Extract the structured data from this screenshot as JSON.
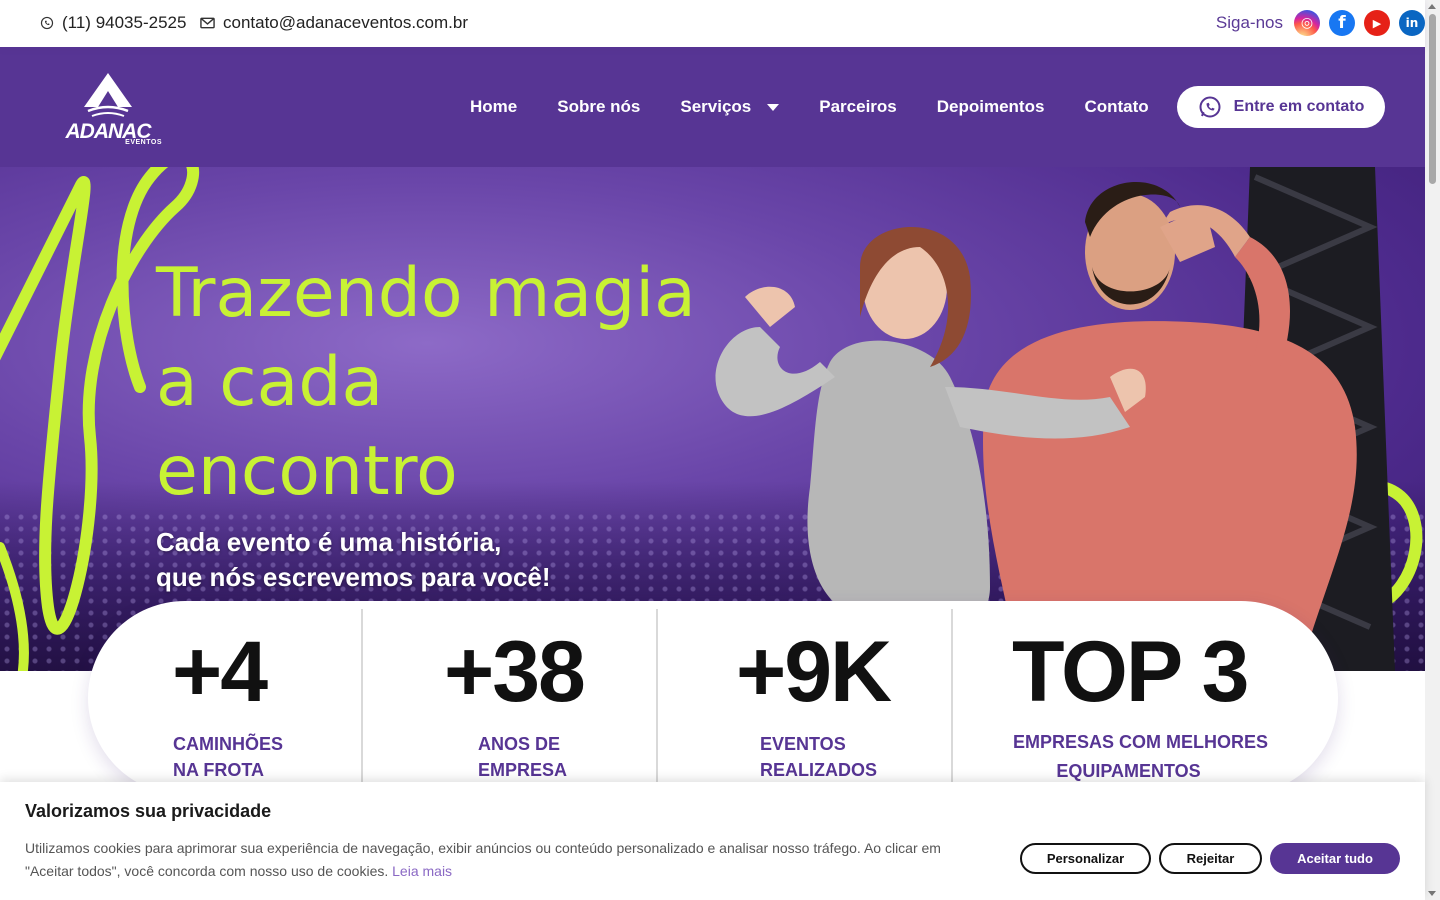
{
  "topbar": {
    "phone": "(11) 94035-2525",
    "email": "contato@adanaceventos.com.br",
    "follow_label": "Siga-nos",
    "social": [
      {
        "name": "instagram-icon",
        "glyph": "◎"
      },
      {
        "name": "facebook-icon",
        "glyph": "f"
      },
      {
        "name": "youtube-icon",
        "glyph": "▶"
      },
      {
        "name": "linkedin-icon",
        "glyph": "in"
      }
    ]
  },
  "logo": {
    "text": "ADANAC",
    "sub": "EVENTOS"
  },
  "nav": {
    "items": [
      "Home",
      "Sobre nós",
      "Serviços",
      "Parceiros",
      "Depoimentos",
      "Contato"
    ],
    "cta": "Entre em contato"
  },
  "hero": {
    "title_lines": [
      "Trazendo magia",
      "a cada",
      "encontro"
    ],
    "subtitle_lines": [
      "Cada evento é uma história,",
      "que nós escrevemos para você!"
    ]
  },
  "stats": [
    {
      "value": "+4",
      "label_lines": [
        "CAMINHÕES",
        "NA FROTA"
      ]
    },
    {
      "value": "+38",
      "label_lines": [
        "ANOS DE",
        "EMPRESA"
      ]
    },
    {
      "value": "+9K",
      "label_lines": [
        "EVENTOS",
        "REALIZADOS"
      ]
    },
    {
      "value": "TOP 3",
      "label_lines": [
        "EMPRESAS COM MELHORES",
        "EQUIPAMENTOS"
      ]
    }
  ],
  "cookie": {
    "title": "Valorizamos sua privacidade",
    "text": "Utilizamos cookies para aprimorar sua experiência de navegação, exibir anúncios ou conteúdo personalizado e analisar nosso tráfego. Ao clicar em \"Aceitar todos\", você concorda com nosso uso de cookies.",
    "link": "Leia mais",
    "buttons": {
      "customize": "Personalizar",
      "reject": "Rejeitar",
      "accept": "Aceitar tudo"
    }
  },
  "colors": {
    "brand_purple": "#573594",
    "accent_lime": "#c8f234"
  }
}
